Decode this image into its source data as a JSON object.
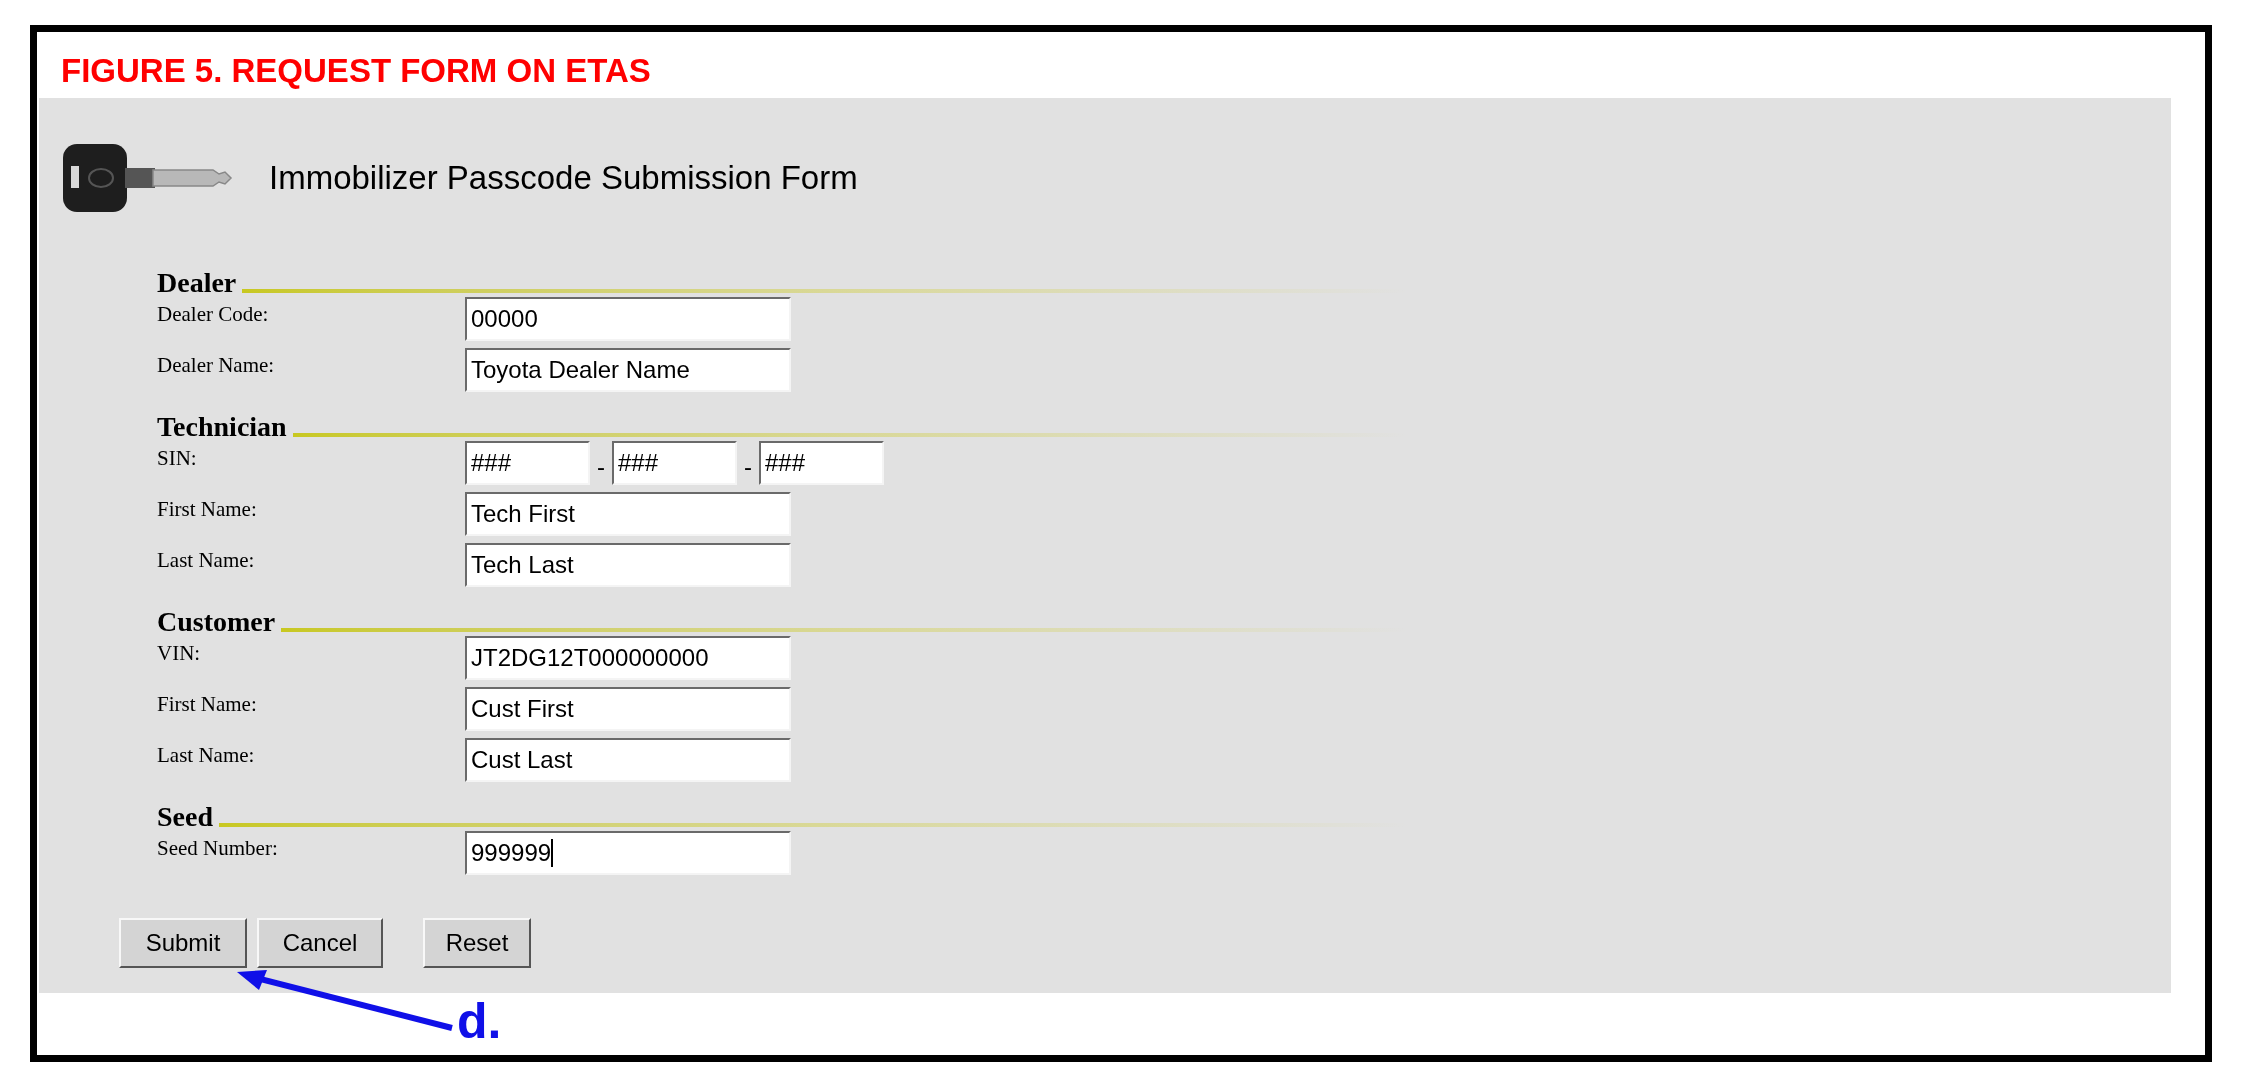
{
  "caption": "FIGURE 5. REQUEST FORM ON ETAS",
  "form": {
    "title": "Immobilizer Passcode Submission Form",
    "sections": [
      {
        "heading": "Dealer",
        "fields": [
          {
            "kind": "text",
            "label": "Dealer Code:",
            "value": "00000",
            "focused": false
          },
          {
            "kind": "text",
            "label": "Dealer Name:",
            "value": "Toyota Dealer Name",
            "focused": false
          }
        ]
      },
      {
        "heading": "Technician",
        "fields": [
          {
            "kind": "split",
            "label": "SIN:",
            "parts": [
              "###",
              "###",
              "###"
            ],
            "separator": "-"
          },
          {
            "kind": "text",
            "label": "First Name:",
            "value": "Tech First",
            "focused": false
          },
          {
            "kind": "text",
            "label": "Last Name:",
            "value": "Tech Last",
            "focused": false
          }
        ]
      },
      {
        "heading": "Customer",
        "fields": [
          {
            "kind": "text",
            "label": "VIN:",
            "value": "JT2DG12T000000000",
            "focused": false
          },
          {
            "kind": "text",
            "label": "First Name:",
            "value": "Cust First",
            "focused": false
          },
          {
            "kind": "text",
            "label": "Last Name:",
            "value": "Cust Last",
            "focused": false
          }
        ]
      },
      {
        "heading": "Seed",
        "fields": [
          {
            "kind": "text",
            "label": "Seed Number:",
            "value": "999999",
            "focused": true
          }
        ]
      }
    ],
    "buttons": [
      "Submit",
      "Cancel",
      "Reset"
    ]
  },
  "callout": {
    "label": "d."
  }
}
